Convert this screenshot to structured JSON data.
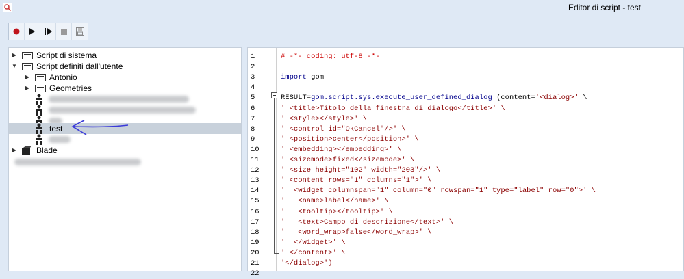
{
  "window": {
    "title": "Editor di script - test"
  },
  "toolbar": {
    "buttons": [
      {
        "name": "record-button",
        "icon": "record-icon"
      },
      {
        "name": "run-button",
        "icon": "play-icon"
      },
      {
        "name": "step-button",
        "icon": "step-icon"
      },
      {
        "name": "stop-button",
        "icon": "stop-icon"
      },
      {
        "name": "save-button",
        "icon": "save-icon"
      }
    ]
  },
  "tree": {
    "system_scripts": "Script di sistema",
    "user_scripts": "Script definiti dall'utente",
    "antonio": "Antonio",
    "geometries": "Geometries",
    "test": "test",
    "blade": "Blade"
  },
  "editor": {
    "line_numbers": [
      "1",
      "2",
      "3",
      "4",
      "5",
      "6",
      "7",
      "8",
      "9",
      "10",
      "11",
      "12",
      "13",
      "14",
      "15",
      "16",
      "17",
      "18",
      "19",
      "20",
      "21",
      "22"
    ],
    "lines": [
      "# -*- coding: utf-8 -*-",
      "",
      "import gom",
      "",
      "RESULT=gom.script.sys.execute_user_defined_dialog (content='<dialog>' \\",
      "' <title>Titolo della finestra di dialogo</title>' \\",
      "' <style></style>' \\",
      "' <control id=\"OkCancel\"/>' \\",
      "' <position>center</position>' \\",
      "' <embedding></embedding>' \\",
      "' <sizemode>fixed</sizemode>' \\",
      "' <size height=\"102\" width=\"203\"/>' \\",
      "' <content rows=\"1\" columns=\"1\">' \\",
      "'  <widget columnspan=\"1\" column=\"0\" rowspan=\"1\" type=\"label\" row=\"0\">' \\",
      "'   <name>label</name>' \\",
      "'   <tooltip></tooltip>' \\",
      "'   <text>Campo di descrizione</text>' \\",
      "'   <word_wrap>false</word_wrap>' \\",
      "'  </widget>' \\",
      "' </content>' \\",
      "'</dialog>')",
      ""
    ]
  },
  "colors": {
    "background": "#dfe9f5",
    "selection": "#c8d1db",
    "annotation_arrow": "#3b3bd9"
  }
}
